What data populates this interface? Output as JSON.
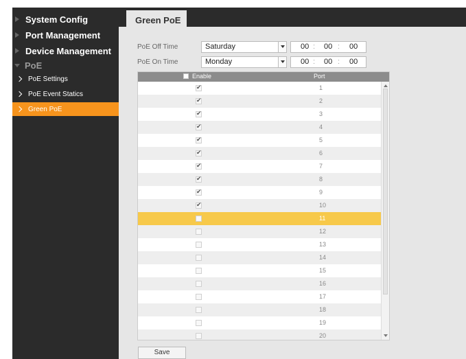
{
  "sidebar": {
    "items": [
      {
        "label": "System Config"
      },
      {
        "label": "Port Management"
      },
      {
        "label": "Device Management"
      },
      {
        "label": "PoE"
      }
    ],
    "sub_items": [
      {
        "label": "PoE Settings"
      },
      {
        "label": "PoE Event Statics"
      },
      {
        "label": "Green PoE",
        "active": true
      }
    ]
  },
  "tab": {
    "label": "Green PoE"
  },
  "off_time": {
    "label": "PoE Off Time",
    "day": "Saturday",
    "hh": "00",
    "mm": "00",
    "ss": "00"
  },
  "on_time": {
    "label": "PoE On Time",
    "day": "Monday",
    "hh": "00",
    "mm": "00",
    "ss": "00"
  },
  "table": {
    "headers": {
      "enable": "Enable",
      "port": "Port"
    },
    "rows": [
      {
        "port": "1",
        "checked": true
      },
      {
        "port": "2",
        "checked": true
      },
      {
        "port": "3",
        "checked": true
      },
      {
        "port": "4",
        "checked": true
      },
      {
        "port": "5",
        "checked": true
      },
      {
        "port": "6",
        "checked": true
      },
      {
        "port": "7",
        "checked": true
      },
      {
        "port": "8",
        "checked": true
      },
      {
        "port": "9",
        "checked": true
      },
      {
        "port": "10",
        "checked": true
      },
      {
        "port": "11",
        "checked": false,
        "highlighted": true
      },
      {
        "port": "12",
        "checked": false
      },
      {
        "port": "13",
        "checked": false
      },
      {
        "port": "14",
        "checked": false
      },
      {
        "port": "15",
        "checked": false
      },
      {
        "port": "16",
        "checked": false
      },
      {
        "port": "17",
        "checked": false
      },
      {
        "port": "18",
        "checked": false
      },
      {
        "port": "19",
        "checked": false
      },
      {
        "port": "20",
        "checked": false
      }
    ]
  },
  "save_label": "Save",
  "colors": {
    "sidebar_bg": "#2b2b2b",
    "active_accent": "#f7941d",
    "row_highlight": "#f7c94a",
    "panel_bg": "#e6e6e6"
  }
}
